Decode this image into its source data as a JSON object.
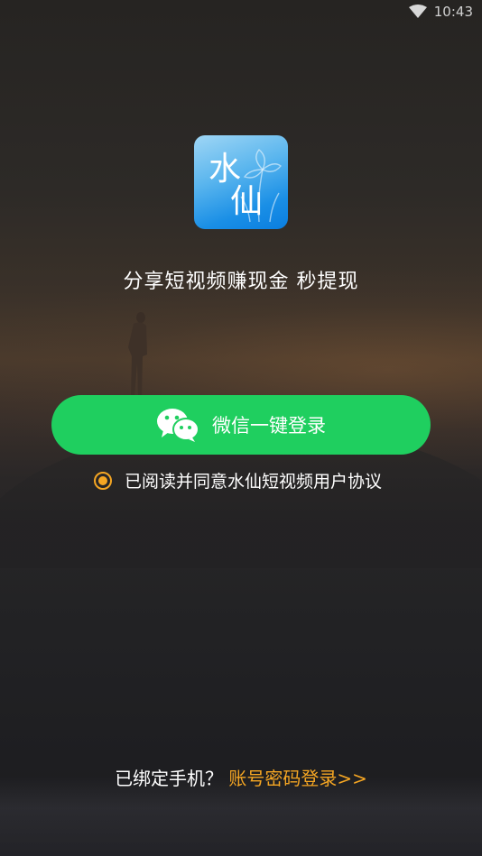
{
  "status_bar": {
    "time": "10:43",
    "wifi_icon": "wifi-icon"
  },
  "app": {
    "icon_char_1": "水",
    "icon_char_2": "仙",
    "slogan": "分享短视频赚现金 秒提现"
  },
  "login": {
    "wechat_label": "微信一键登录",
    "wechat_icon": "wechat-icon",
    "agreement_text": "已阅读并同意水仙短视频用户协议",
    "agreement_checked": true
  },
  "bottom": {
    "question": "已绑定手机？",
    "password_login_link": "账号密码登录>>"
  },
  "colors": {
    "accent_green": "#1fcf5f",
    "accent_orange": "#f5a623",
    "icon_blue": "#1a8fe6"
  }
}
